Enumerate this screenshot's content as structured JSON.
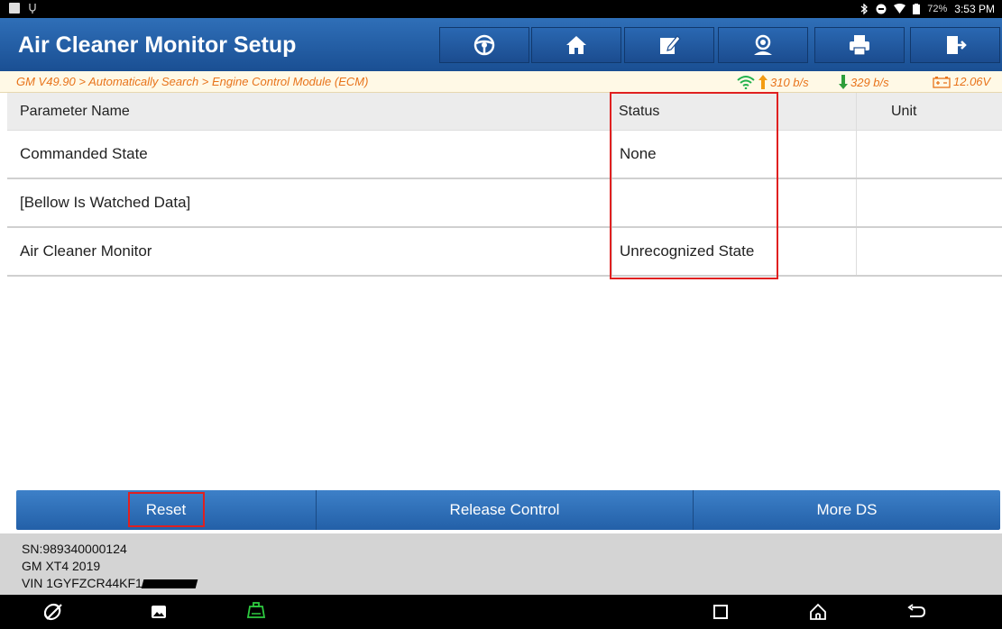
{
  "status_bar": {
    "battery_text": "72%",
    "time": "3:53 PM"
  },
  "header": {
    "title": "Air Cleaner Monitor Setup",
    "toolbar_icons": [
      "steering-wheel-icon",
      "home-icon",
      "edit-icon",
      "user-support-icon",
      "print-icon",
      "exit-icon"
    ]
  },
  "breadcrumb": {
    "path": "GM V49.90 > Automatically Search > Engine Control Module (ECM)",
    "upload_speed": "310 b/s",
    "download_speed": "329 b/s",
    "voltage": "12.06V"
  },
  "table": {
    "headers": {
      "name": "Parameter Name",
      "status": "Status",
      "unit": "Unit"
    },
    "rows": [
      {
        "name": "Commanded State",
        "status": "None",
        "unit": ""
      },
      {
        "name": "[Bellow Is Watched Data]",
        "status": "",
        "unit": ""
      },
      {
        "name": "Air Cleaner Monitor",
        "status": "Unrecognized State",
        "unit": ""
      }
    ]
  },
  "actions": {
    "reset": "Reset",
    "release_control": "Release Control",
    "more_ds": "More DS"
  },
  "vehicle_info": {
    "sn": "SN:989340000124",
    "model": "GM XT4 2019",
    "vin": "VIN 1GYFZCR44KF1"
  },
  "colors": {
    "accent_blue": "#2360a8",
    "breadcrumb_orange": "#e8731a",
    "highlight_red": "#e02020"
  }
}
